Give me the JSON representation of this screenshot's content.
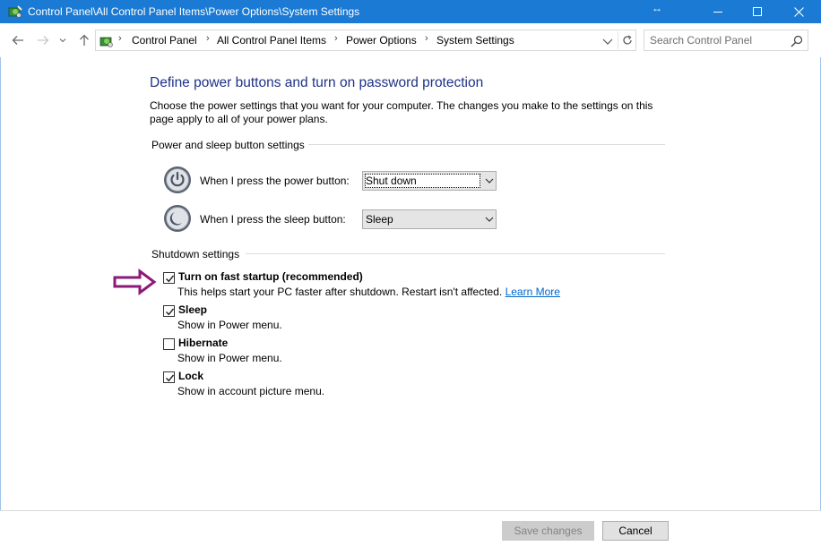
{
  "window": {
    "title": "Control Panel\\All Control Panel Items\\Power Options\\System Settings",
    "resize_glyph": "↔",
    "titlebar_color": "#1a7ad4"
  },
  "address_bar": {
    "breadcrumbs": [
      "Control Panel",
      "All Control Panel Items",
      "Power Options",
      "System Settings"
    ],
    "separator": "›"
  },
  "search": {
    "placeholder": "Search Control Panel"
  },
  "page": {
    "heading": "Define power buttons and turn on password protection",
    "description": "Choose the power settings that you want for your computer. The changes you make to the settings on this page apply to all of your power plans.",
    "power_sleep_group": {
      "title": "Power and sleep button settings",
      "power_button": {
        "label": "When I press the power button:",
        "value": "Shut down",
        "icon": "power-icon"
      },
      "sleep_button": {
        "label": "When I press the sleep button:",
        "value": "Sleep",
        "icon": "sleep-icon"
      }
    },
    "shutdown_group": {
      "title": "Shutdown settings",
      "options": [
        {
          "label": "Turn on fast startup (recommended)",
          "description": "This helps start your PC faster after shutdown. Restart isn't affected.",
          "link": "Learn More",
          "checked": true
        },
        {
          "label": "Sleep",
          "description": "Show in Power menu.",
          "checked": true
        },
        {
          "label": "Hibernate",
          "description": "Show in Power menu.",
          "checked": false
        },
        {
          "label": "Lock",
          "description": "Show in account picture menu.",
          "checked": true
        }
      ]
    },
    "annotation_arrow_color": "#8b1a7a",
    "heading_color": "#1e3287",
    "link_color": "#0066cc"
  },
  "footer": {
    "save_label": "Save changes",
    "cancel_label": "Cancel"
  }
}
